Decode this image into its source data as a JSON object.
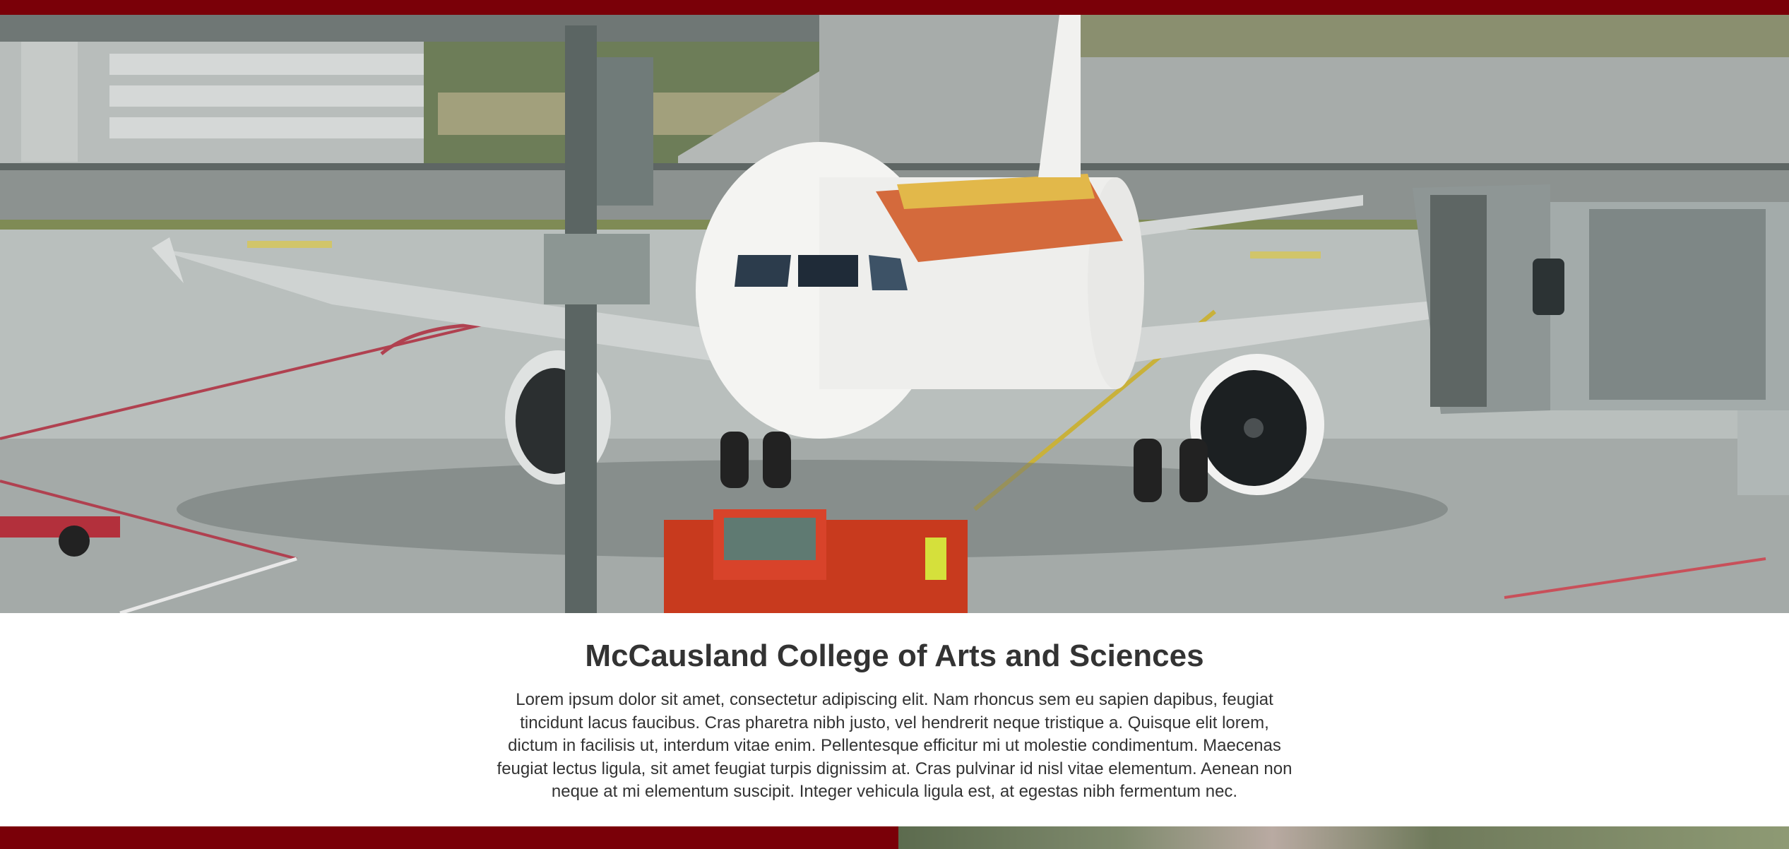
{
  "hero": {
    "image_alt": "Airplane parked at an airport gate with a jet bridge and a red pushback tug"
  },
  "content": {
    "title": "McCausland College of Arts and Sciences",
    "body": "Lorem ipsum dolor sit amet, consectetur adipiscing elit. Nam rhoncus sem eu sapien dapibus, feugiat tincidunt lacus faucibus. Cras pharetra nibh justo, vel hendrerit neque tristique a. Quisque elit lorem, dictum in facilisis ut, interdum vitae enim. Pellentesque efficitur mi ut molestie condimentum. Maecenas feugiat lectus ligula, sit amet feugiat turpis dignissim at. Cras pulvinar id nisl vitae elementum. Aenean non neque at mi elementum suscipit. Integer vehicula ligula est, at egestas nibh fermentum nec."
  },
  "colors": {
    "brand": "#7a0008",
    "text": "#333333",
    "background": "#ffffff"
  }
}
